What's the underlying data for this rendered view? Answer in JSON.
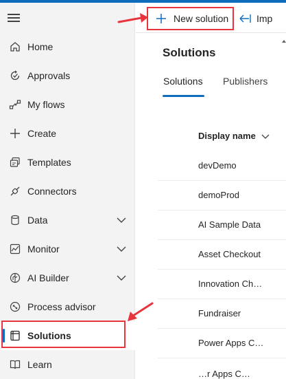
{
  "sidebar": {
    "menu_label": "Menu",
    "items": [
      {
        "label": "Home",
        "icon": "home-icon"
      },
      {
        "label": "Approvals",
        "icon": "approvals-icon"
      },
      {
        "label": "My flows",
        "icon": "flows-icon"
      },
      {
        "label": "Create",
        "icon": "plus-icon"
      },
      {
        "label": "Templates",
        "icon": "templates-icon"
      },
      {
        "label": "Connectors",
        "icon": "connectors-icon"
      },
      {
        "label": "Data",
        "icon": "database-icon",
        "expandable": true
      },
      {
        "label": "Monitor",
        "icon": "monitor-icon",
        "expandable": true
      },
      {
        "label": "AI Builder",
        "icon": "ai-builder-icon",
        "expandable": true
      },
      {
        "label": "Process advisor",
        "icon": "process-advisor-icon"
      },
      {
        "label": "Solutions",
        "icon": "solutions-icon",
        "selected": true
      },
      {
        "label": "Learn",
        "icon": "learn-icon"
      }
    ]
  },
  "command_bar": {
    "new_solution": "New solution",
    "import": "Imp"
  },
  "page": {
    "title": "Solutions",
    "tabs": [
      "Solutions",
      "Publishers"
    ],
    "active_tab": "Solutions"
  },
  "table": {
    "column_header": "Display name",
    "rows": [
      "devDemo",
      "demoProd",
      "AI Sample Data",
      "Asset Checkout",
      "Innovation Ch…",
      "Fundraiser",
      "Power Apps C…",
      "…r Apps C…"
    ]
  },
  "colors": {
    "accent": "#0f6cbd",
    "annotation": "#e8343d",
    "sidebar_bg": "#f3f3f3"
  }
}
